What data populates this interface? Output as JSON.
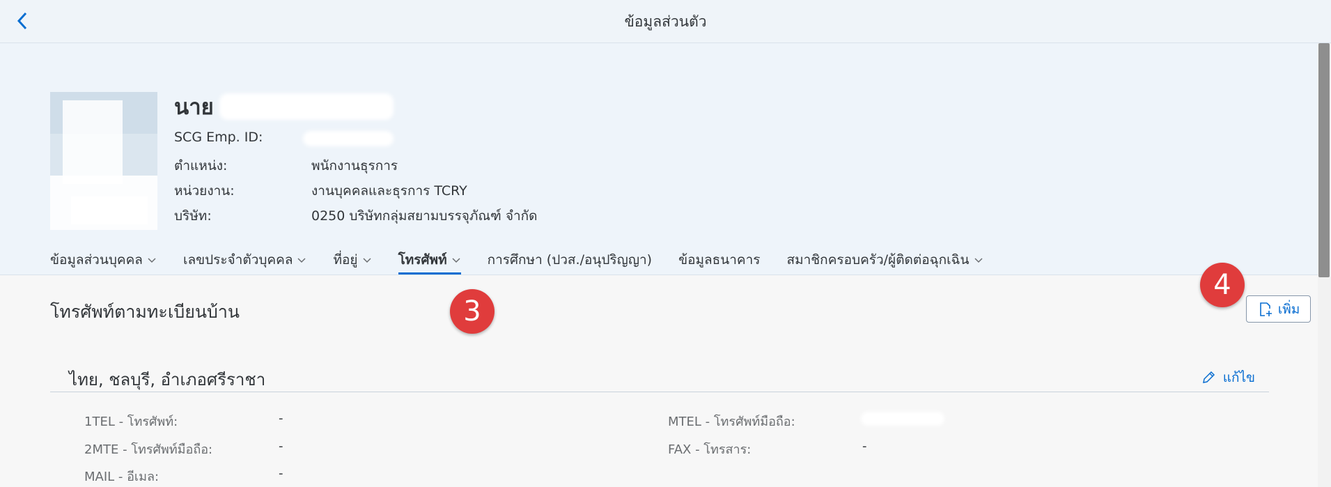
{
  "shell": {
    "title": "ข้อมูลส่วนตัว"
  },
  "profile": {
    "name_prefix": "นาย",
    "fields": [
      {
        "label": "SCG Emp. ID:",
        "value": ""
      },
      {
        "label": "ตำแหน่ง:",
        "value": "พนักงานธุรการ"
      },
      {
        "label": "หน่วยงาน:",
        "value": "งานบุคคลและธุรการ TCRY"
      },
      {
        "label": "บริษัท:",
        "value": "0250 บริษัทกลุ่มสยามบรรจุภัณฑ์ จำกัด"
      }
    ]
  },
  "tabs": [
    {
      "label": "ข้อมูลส่วนบุคคล",
      "has_menu": true
    },
    {
      "label": "เลขประจำตัวบุคคล",
      "has_menu": true
    },
    {
      "label": "ที่อยู่",
      "has_menu": true
    },
    {
      "label": "โทรศัพท์",
      "has_menu": true,
      "selected": true
    },
    {
      "label": "การศึกษา (ปวส./อนุปริญญา)",
      "has_menu": false
    },
    {
      "label": "ข้อมูลธนาคาร",
      "has_menu": false
    },
    {
      "label": "สมาชิกครอบครัว/ผู้ติดต่อฉุกเฉิน",
      "has_menu": true
    }
  ],
  "section": {
    "title": "โทรศัพท์ตามทะเบียนบ้าน",
    "add_label": "เพิ่ม",
    "subsection_title": "ไทย, ชลบุรี, อำเภอศรีราชา",
    "edit_label": "แก้ไข",
    "fields": [
      {
        "label": "1TEL - โทรศัพท์:",
        "value": "-"
      },
      {
        "label": "2MTE - โทรศัพท์มือถือ:",
        "value": "-"
      },
      {
        "label": "MAIL - อีเมล:",
        "value": "-"
      },
      {
        "label": "MTEL - โทรศัพท์มือถือ:",
        "value": ""
      },
      {
        "label": "FAX - โทรสาร:",
        "value": "-"
      }
    ]
  },
  "markers": {
    "m3": "3",
    "m4": "4"
  },
  "colors": {
    "accent": "#0a6ed1",
    "marker": "#e03c3c",
    "header_bg": "#eef4fa"
  }
}
